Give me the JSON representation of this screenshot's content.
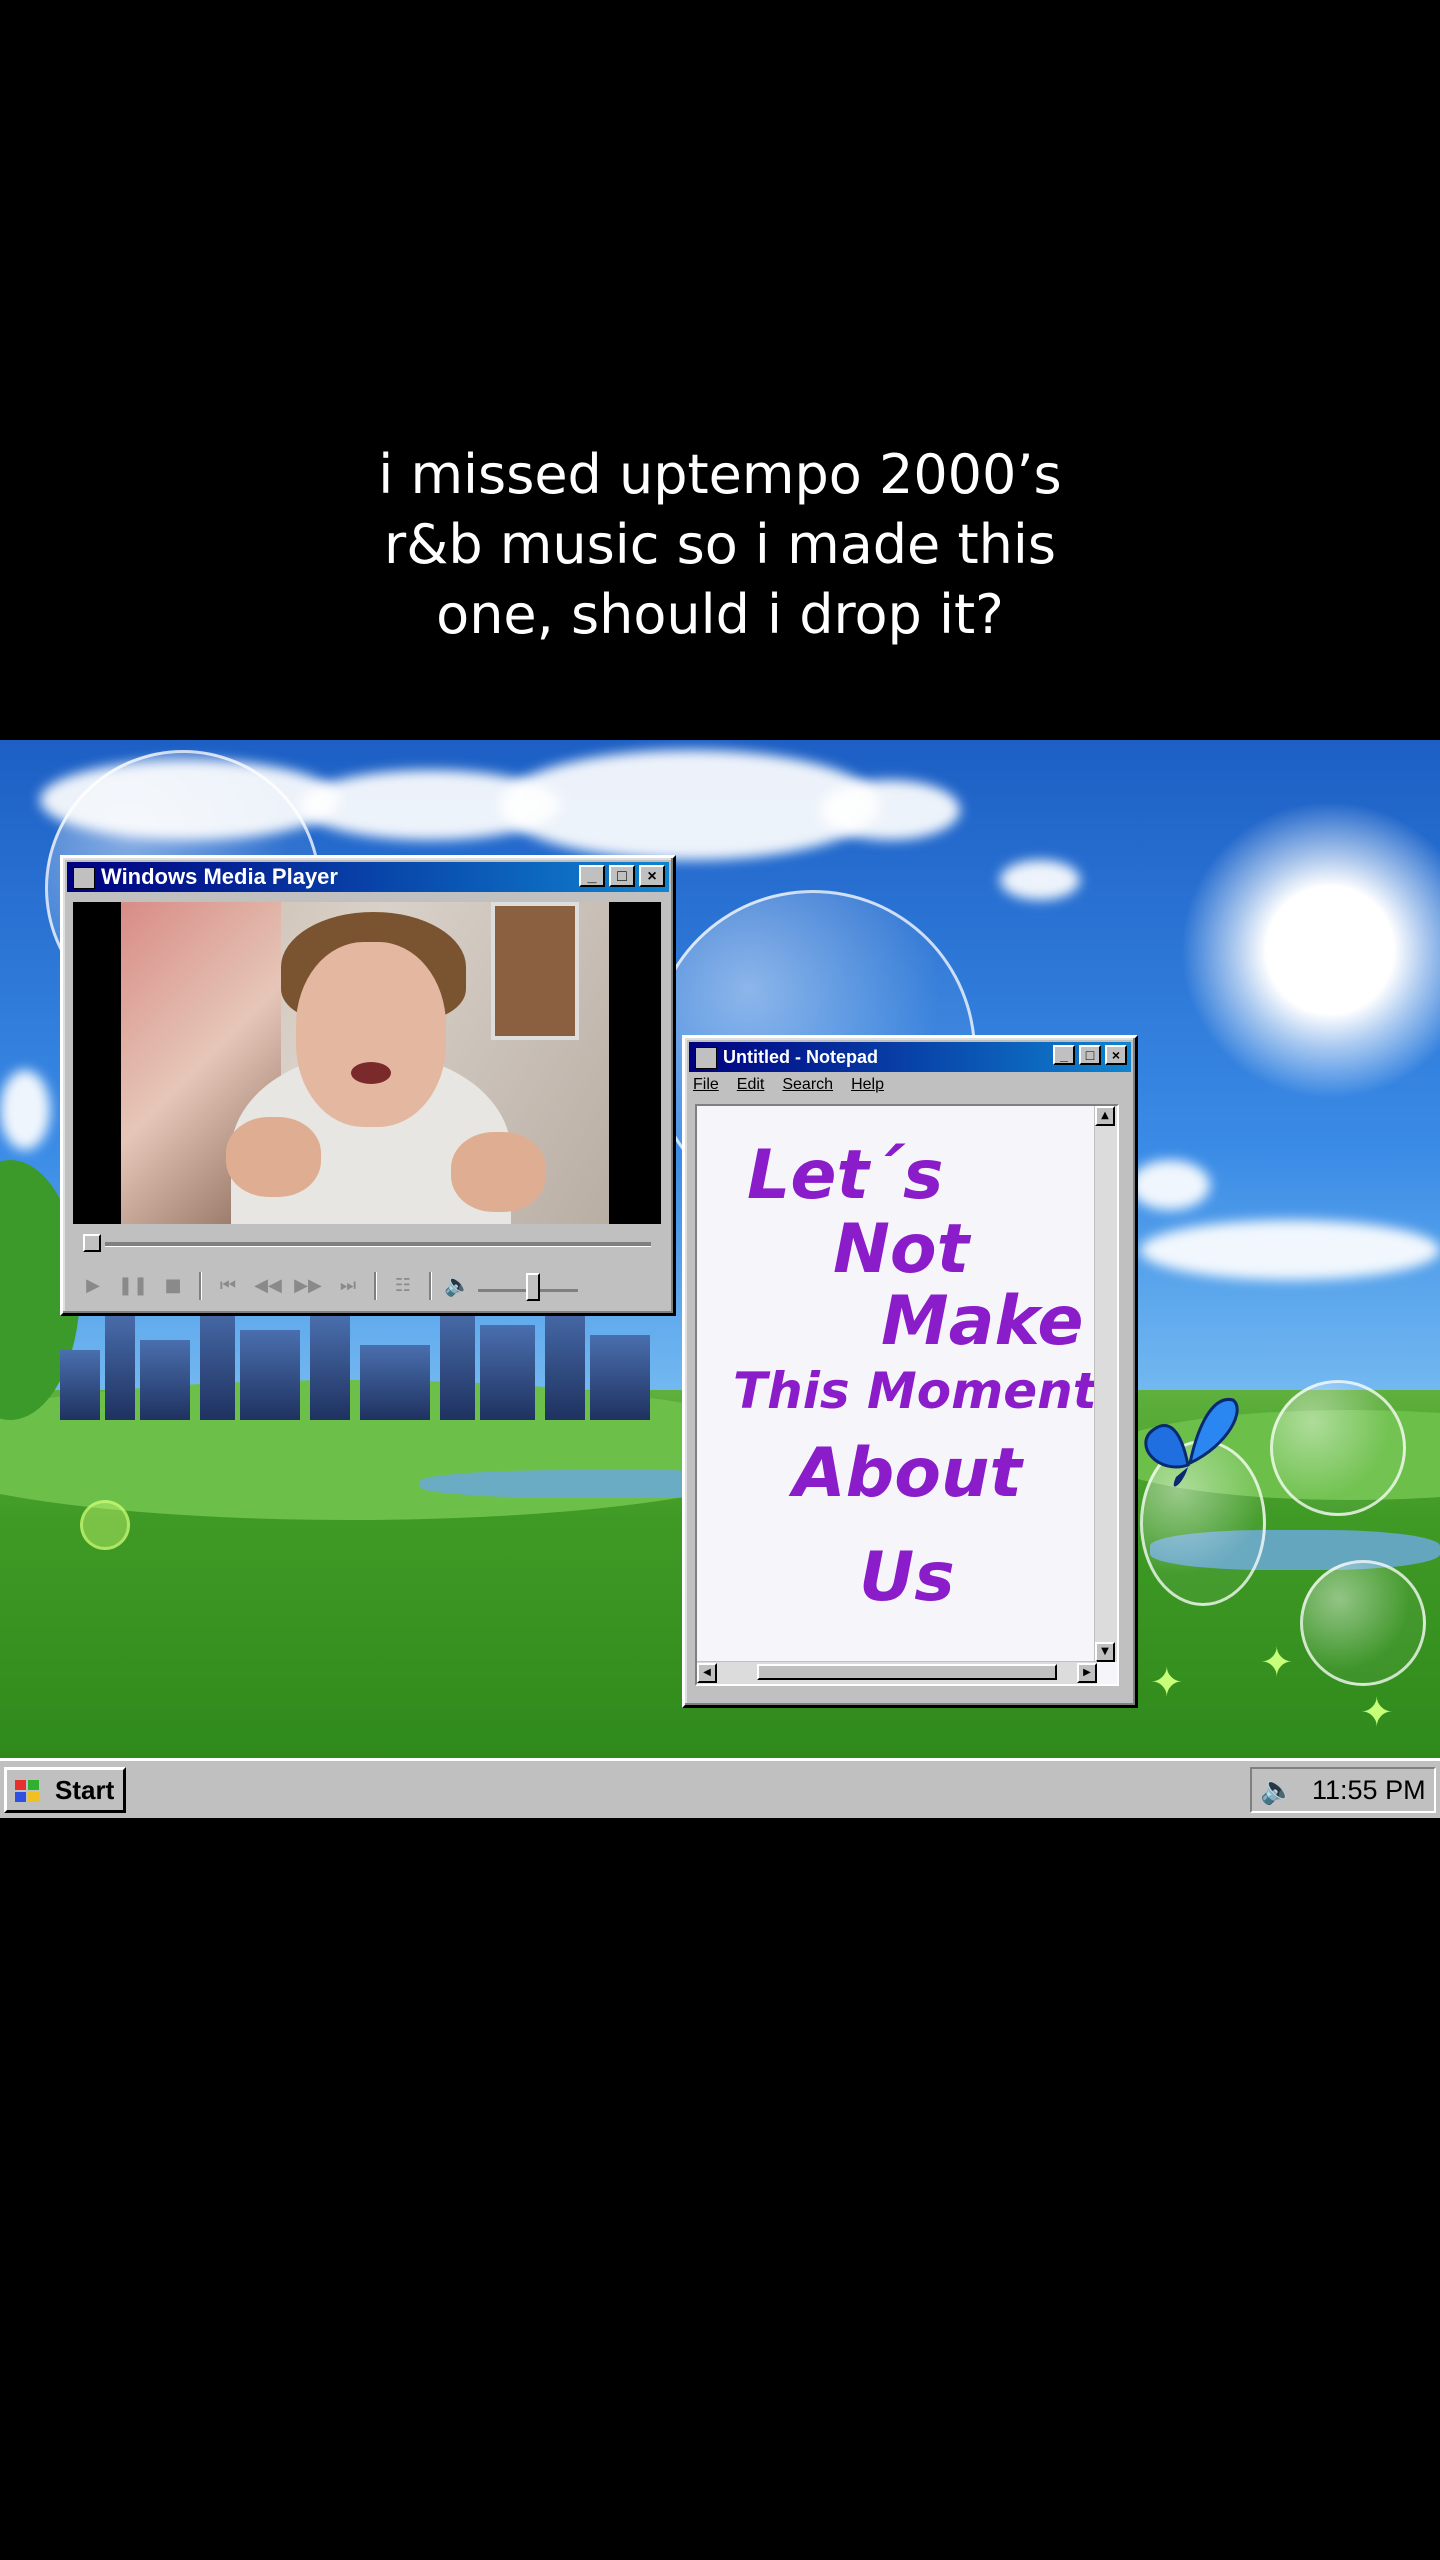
{
  "caption": {
    "line1": "i missed uptempo 2000’s",
    "line2": "r&b music so i made this",
    "line3": "one, should i drop it?"
  },
  "media_player": {
    "title": "Windows Media Player",
    "controls": [
      "play",
      "pause",
      "stop",
      "skip-back",
      "rewind",
      "fast-forward",
      "skip-forward",
      "playlist"
    ]
  },
  "notepad": {
    "title": "Untitled - Notepad",
    "menu": [
      "File",
      "Edit",
      "Search",
      "Help"
    ],
    "lyrics": [
      "Let´s",
      "Not",
      "Make",
      "This Moment",
      "About",
      "Us"
    ],
    "text_color": "#8a1cc9"
  },
  "taskbar": {
    "start_label": "Start",
    "clock": "11:55 PM"
  },
  "window_buttons": {
    "minimize": "_",
    "maximize": "□",
    "close": "×"
  },
  "colors": {
    "titlebar": "#000080",
    "win_face": "#c0c0c0"
  }
}
